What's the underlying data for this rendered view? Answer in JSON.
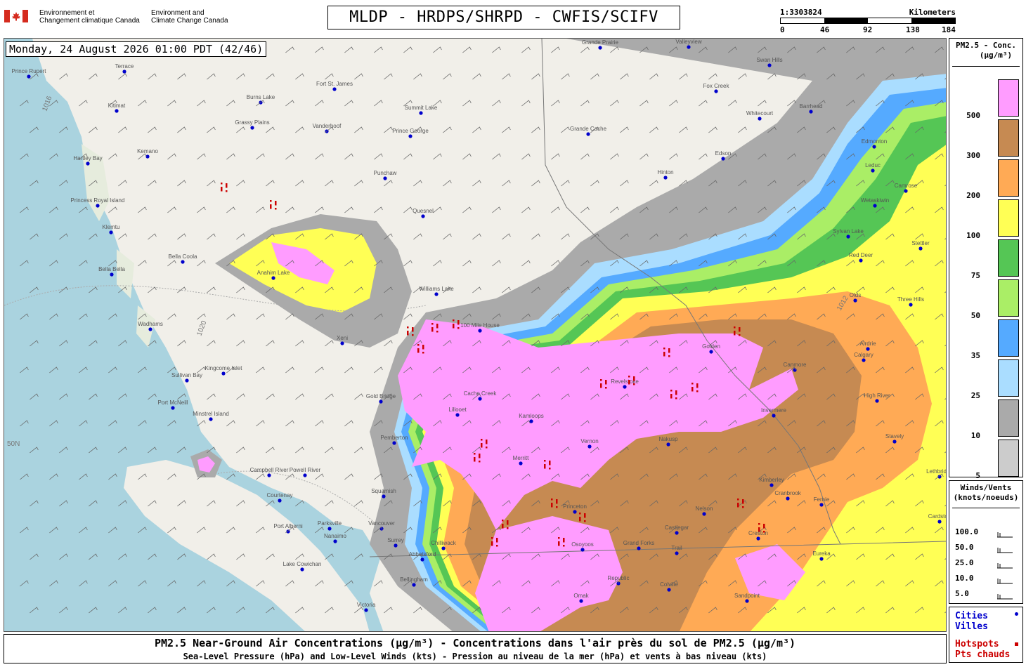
{
  "header": {
    "agency_fr": "Environnement et\nChangement climatique Canada",
    "agency_en": "Environment and\nClimate Change Canada",
    "title": "MLDP - HRDPS/SHRPD - CWFIS/SCIFV",
    "scale": {
      "ratio": "1:3303824",
      "unit": "Kilometers",
      "ticks": [
        "0",
        "46",
        "92",
        "138",
        "184"
      ]
    }
  },
  "map": {
    "timestamp": "Monday, 24 August 2026 01:00 PDT (42/46)",
    "places": [
      [
        "Prince Rupert",
        40,
        108
      ],
      [
        "Hartley Bay",
        124,
        232
      ],
      [
        "Kitimat",
        165,
        157
      ],
      [
        "Terrace",
        176,
        101
      ],
      [
        "Kemano",
        209,
        222
      ],
      [
        "Princess Royal Island",
        138,
        292
      ],
      [
        "Klemtu",
        157,
        330
      ],
      [
        "Bella Bella",
        158,
        390
      ],
      [
        "Bella Coola",
        259,
        372
      ],
      [
        "Wadhams",
        213,
        468
      ],
      [
        "Sullivan Bay",
        265,
        541
      ],
      [
        "Port McNeill",
        245,
        580
      ],
      [
        "Kingcome Inlet",
        317,
        531
      ],
      [
        "Minstrel Island",
        299,
        596
      ],
      [
        "Campbell River",
        382,
        676
      ],
      [
        "Courtenay",
        397,
        712
      ],
      [
        "Powell River",
        433,
        676
      ],
      [
        "Port Alberni",
        409,
        756
      ],
      [
        "Parksville",
        468,
        752
      ],
      [
        "Nanaimo",
        476,
        770
      ],
      [
        "Lake Cowichan",
        429,
        810
      ],
      [
        "Victoria",
        520,
        868
      ],
      [
        "Squamish",
        545,
        706
      ],
      [
        "Vancouver",
        542,
        752
      ],
      [
        "Surrey",
        562,
        776
      ],
      [
        "Abbotsford",
        600,
        796
      ],
      [
        "Chilliwack",
        630,
        780
      ],
      [
        "Bellingham",
        588,
        832
      ],
      [
        "Pemberton",
        560,
        630
      ],
      [
        "Gold Bridge",
        541,
        571
      ],
      [
        "Lillooet",
        650,
        590
      ],
      [
        "Cache Creek",
        682,
        567
      ],
      [
        "Kamloops",
        755,
        599
      ],
      [
        "Merritt",
        740,
        659
      ],
      [
        "Princeton",
        817,
        728
      ],
      [
        "Osoyoos",
        828,
        782
      ],
      [
        "Omak",
        826,
        855
      ],
      [
        "Vernon",
        838,
        635
      ],
      [
        "Revelstoke",
        888,
        550
      ],
      [
        "Nakusp",
        950,
        632
      ],
      [
        "Castlegar",
        962,
        758
      ],
      [
        "Nelson",
        1001,
        731
      ],
      [
        "Trail",
        962,
        787
      ],
      [
        "Colville",
        951,
        839
      ],
      [
        "Grand Forks",
        908,
        780
      ],
      [
        "Republic",
        879,
        830
      ],
      [
        "Cranbrook",
        1120,
        709
      ],
      [
        "Fernie",
        1168,
        718
      ],
      [
        "Kimberley",
        1097,
        690
      ],
      [
        "Creston",
        1078,
        766
      ],
      [
        "Golden",
        1011,
        500
      ],
      [
        "Invermere",
        1100,
        591
      ],
      [
        "Canmore",
        1130,
        526
      ],
      [
        "Calgary",
        1228,
        512
      ],
      [
        "High River",
        1247,
        570
      ],
      [
        "Airdrie",
        1234,
        496
      ],
      [
        "Olds",
        1216,
        427
      ],
      [
        "Three Hills",
        1295,
        433
      ],
      [
        "Red Deer",
        1224,
        370
      ],
      [
        "Sylvan Lake",
        1206,
        336
      ],
      [
        "Stettler",
        1309,
        353
      ],
      [
        "Edmonton",
        1243,
        208
      ],
      [
        "Leduc",
        1241,
        242
      ],
      [
        "Wetaskiwin",
        1244,
        292
      ],
      [
        "Camrose",
        1288,
        271
      ],
      [
        "Edson",
        1028,
        225
      ],
      [
        "Hinton",
        946,
        252
      ],
      [
        "Whitecourt",
        1080,
        168
      ],
      [
        "Barrhead",
        1153,
        158
      ],
      [
        "Swan Hills",
        1094,
        92
      ],
      [
        "Fox Creek",
        1018,
        129
      ],
      [
        "Grande Cache",
        836,
        190
      ],
      [
        "Grande Prairie",
        853,
        67
      ],
      [
        "Valleyview",
        979,
        66
      ],
      [
        "Prince George",
        583,
        193
      ],
      [
        "Vanderhoof",
        464,
        186
      ],
      [
        "Fort St. James",
        475,
        126
      ],
      [
        "Burns Lake",
        370,
        145
      ],
      [
        "Grassy Plains",
        358,
        181
      ],
      [
        "Summit Lake",
        598,
        160
      ],
      [
        "Punchaw",
        547,
        253
      ],
      [
        "Quesnel",
        601,
        307
      ],
      [
        "Williams Lake",
        620,
        418
      ],
      [
        "100 Mile House",
        682,
        470
      ],
      [
        "Anahim Lake",
        388,
        395
      ],
      [
        "Xeni",
        486,
        488
      ],
      [
        "Stavely",
        1272,
        628
      ],
      [
        "Lethbridge",
        1336,
        678
      ],
      [
        "Cardston",
        1336,
        742
      ],
      [
        "Eureka",
        1168,
        795
      ],
      [
        "Sandpoint",
        1062,
        855
      ]
    ],
    "pressure_labels": [
      "1016",
      "1020",
      "1012",
      "50N"
    ]
  },
  "legend": {
    "title": "PM2.5 - Conc.",
    "units": "(μg/m³)",
    "levels": [
      {
        "label": "500",
        "color": "#ff9cff"
      },
      {
        "label": "300",
        "color": "#c68a52"
      },
      {
        "label": "200",
        "color": "#ffaa55"
      },
      {
        "label": "100",
        "color": "#ffff55"
      },
      {
        "label": "75",
        "color": "#55c655"
      },
      {
        "label": "50",
        "color": "#aaee66"
      },
      {
        "label": "35",
        "color": "#55aaff"
      },
      {
        "label": "25",
        "color": "#aaddff"
      },
      {
        "label": "10",
        "color": "#aaaaaa"
      },
      {
        "label": "5",
        "color": "#cccccc"
      }
    ]
  },
  "winds_legend": {
    "title": "Winds/Vents",
    "units": "(knots/noeuds)",
    "rows": [
      "100.0",
      "50.0",
      "25.0",
      "10.0",
      "5.0"
    ]
  },
  "keys": {
    "cities_en": "Cities",
    "cities_fr": "Villes",
    "cities_color": "#0000cc",
    "hotspots_en": "Hotspots",
    "hotspots_fr": "Pts chauds",
    "hotspots_color": "#cc0000"
  },
  "footer": {
    "line1": "PM2.5 Near-Ground Air Concentrations (μg/m³) - Concentrations dans l'air près du sol de PM2.5 (μg/m³)",
    "line2": "Sea-Level Pressure (hPa) and Low-Level Winds (kts) - Pression au niveau de la mer (hPa) et vents à bas niveau (kts)"
  }
}
